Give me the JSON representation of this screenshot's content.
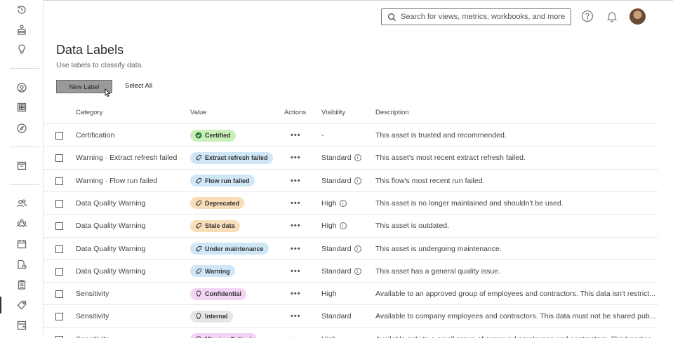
{
  "header": {
    "search_placeholder": "Search for views, metrics, workbooks, and more"
  },
  "page": {
    "title": "Data Labels",
    "subtitle": "Use labels to classify data."
  },
  "toolbar": {
    "new_label": "New Label",
    "select_all": "Select All"
  },
  "table": {
    "columns": [
      "Category",
      "Value",
      "Actions",
      "Visibility",
      "Description"
    ],
    "rows": [
      {
        "category": "Certification",
        "value": "Certified",
        "badge_color": "#c9f0b8",
        "icon": "check-circle-icon",
        "actions": "•••",
        "visibility": "-",
        "info": false,
        "description": "This asset is trusted and recommended."
      },
      {
        "category": "Warning · Extract refresh failed",
        "value": "Extract refresh failed",
        "badge_color": "#cfe6f7",
        "icon": "warning-tag-icon",
        "actions": "•••",
        "visibility": "Standard",
        "info": true,
        "description": "This asset's most recent extract refresh failed."
      },
      {
        "category": "Warning · Flow run failed",
        "value": "Flow run failed",
        "badge_color": "#cfe6f7",
        "icon": "warning-tag-icon",
        "actions": "•••",
        "visibility": "Standard",
        "info": true,
        "description": "This flow's most recent run failed."
      },
      {
        "category": "Data Quality Warning",
        "value": "Deprecated",
        "badge_color": "#f7ddb8",
        "icon": "warning-tag-icon",
        "actions": "•••",
        "visibility": "High",
        "info": true,
        "description": "This asset is no longer maintained and shouldn't be used."
      },
      {
        "category": "Data Quality Warning",
        "value": "Stale data",
        "badge_color": "#f7ddb8",
        "icon": "warning-tag-icon",
        "actions": "•••",
        "visibility": "High",
        "info": true,
        "description": "This asset is outdated."
      },
      {
        "category": "Data Quality Warning",
        "value": "Under maintenance",
        "badge_color": "#cfe6f7",
        "icon": "warning-tag-icon",
        "actions": "•••",
        "visibility": "Standard",
        "info": true,
        "description": "This asset is undergoing maintenance."
      },
      {
        "category": "Data Quality Warning",
        "value": "Warning",
        "badge_color": "#cfe6f7",
        "icon": "warning-tag-icon",
        "actions": "•••",
        "visibility": "Standard",
        "info": true,
        "description": "This asset has a general quality issue."
      },
      {
        "category": "Sensitivity",
        "value": "Confidential",
        "badge_color": "#f4d4f4",
        "icon": "bulb-icon",
        "actions": "•••",
        "visibility": "High",
        "info": false,
        "description": "Available to an approved group of employees and contractors. This data isn't restrict..."
      },
      {
        "category": "Sensitivity",
        "value": "Internal",
        "badge_color": "#e6e6e6",
        "icon": "bulb-icon",
        "actions": "•••",
        "visibility": "Standard",
        "info": false,
        "description": "Available to company employees and contractors. This data must not be shared pub..."
      },
      {
        "category": "Sensitivity",
        "value": "Mission Critical",
        "badge_color": "#f4d4f4",
        "icon": "bulb-icon",
        "actions": "•••",
        "visibility": "High",
        "info": false,
        "description": "Available only to a small group of approved employees and contractors. Third parties..."
      }
    ]
  },
  "sidebar": {
    "icons": [
      "recents-icon",
      "collections-icon",
      "recommendations-icon",
      "personal-space-icon",
      "projects-icon",
      "explore-icon",
      "external-assets-icon",
      "users-icon",
      "groups-icon",
      "schedules-icon",
      "tasks-icon",
      "jobs-icon",
      "data-labels-icon",
      "site-settings-icon"
    ]
  }
}
